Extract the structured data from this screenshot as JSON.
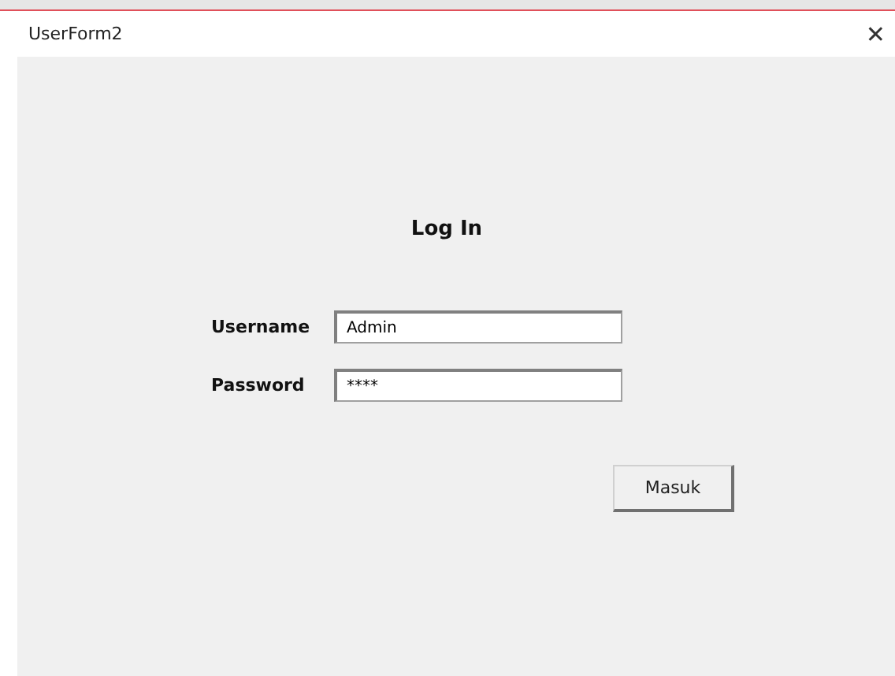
{
  "window": {
    "title": "UserForm2",
    "close": "✕"
  },
  "form": {
    "heading": "Log In",
    "fields": [
      {
        "label": "Username",
        "value": "Admin"
      },
      {
        "label": "Password",
        "value": "****"
      }
    ],
    "button": "Masuk"
  }
}
